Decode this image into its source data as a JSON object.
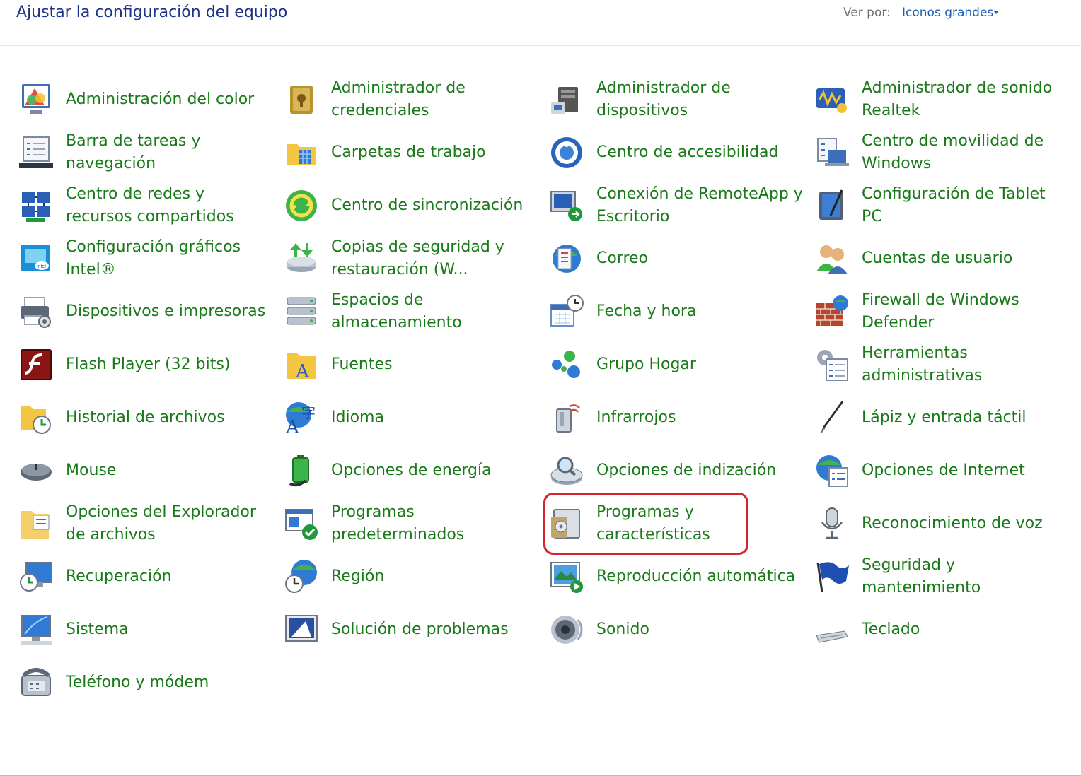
{
  "header": {
    "title": "Ajustar la configuración del equipo",
    "view_by_label": "Ver por:",
    "view_by_value": "Iconos grandes"
  },
  "items": [
    {
      "label": "Administración del color",
      "icon": "color-management-icon"
    },
    {
      "label": "Administrador de credenciales",
      "icon": "credential-manager-icon"
    },
    {
      "label": "Administrador de dispositivos",
      "icon": "device-manager-icon"
    },
    {
      "label": "Administrador de sonido Realtek",
      "icon": "realtek-audio-icon"
    },
    {
      "label": "Barra de tareas y navegación",
      "icon": "taskbar-icon"
    },
    {
      "label": "Carpetas de trabajo",
      "icon": "work-folders-icon"
    },
    {
      "label": "Centro de accesibilidad",
      "icon": "ease-of-access-icon"
    },
    {
      "label": "Centro de movilidad de Windows",
      "icon": "mobility-center-icon"
    },
    {
      "label": "Centro de redes y recursos compartidos",
      "icon": "network-center-icon"
    },
    {
      "label": "Centro de sincronización",
      "icon": "sync-center-icon"
    },
    {
      "label": "Conexión de RemoteApp y Escritorio",
      "icon": "remoteapp-icon"
    },
    {
      "label": "Configuración de Tablet PC",
      "icon": "tablet-pc-icon"
    },
    {
      "label": "Configuración gráficos Intel®",
      "icon": "intel-graphics-icon"
    },
    {
      "label": "Copias de seguridad y restauración (W...",
      "icon": "backup-restore-icon"
    },
    {
      "label": "Correo",
      "icon": "mail-icon"
    },
    {
      "label": "Cuentas de usuario",
      "icon": "user-accounts-icon"
    },
    {
      "label": "Dispositivos e impresoras",
      "icon": "printer-icon"
    },
    {
      "label": "Espacios de almacenamiento",
      "icon": "storage-spaces-icon"
    },
    {
      "label": "Fecha y hora",
      "icon": "date-time-icon"
    },
    {
      "label": "Firewall de Windows Defender",
      "icon": "firewall-icon"
    },
    {
      "label": "Flash Player (32 bits)",
      "icon": "flash-player-icon"
    },
    {
      "label": "Fuentes",
      "icon": "fonts-icon"
    },
    {
      "label": "Grupo Hogar",
      "icon": "homegroup-icon"
    },
    {
      "label": "Herramientas administrativas",
      "icon": "admin-tools-icon"
    },
    {
      "label": "Historial de archivos",
      "icon": "file-history-icon"
    },
    {
      "label": "Idioma",
      "icon": "language-icon"
    },
    {
      "label": "Infrarrojos",
      "icon": "infrared-icon"
    },
    {
      "label": "Lápiz y entrada táctil",
      "icon": "pen-icon"
    },
    {
      "label": "Mouse",
      "icon": "mouse-icon"
    },
    {
      "label": "Opciones de energía",
      "icon": "power-options-icon"
    },
    {
      "label": "Opciones de indización",
      "icon": "indexing-icon"
    },
    {
      "label": "Opciones de Internet",
      "icon": "internet-options-icon"
    },
    {
      "label": "Opciones del Explorador de archivos",
      "icon": "folder-options-icon"
    },
    {
      "label": "Programas predeterminados",
      "icon": "default-programs-icon"
    },
    {
      "label": "Programas y características",
      "icon": "programs-features-icon"
    },
    {
      "label": "Reconocimiento de voz",
      "icon": "microphone-icon"
    },
    {
      "label": "Recuperación",
      "icon": "recovery-icon"
    },
    {
      "label": "Región",
      "icon": "region-icon"
    },
    {
      "label": "Reproducción automática",
      "icon": "autoplay-icon"
    },
    {
      "label": "Seguridad y mantenimiento",
      "icon": "security-flag-icon"
    },
    {
      "label": "Sistema",
      "icon": "system-icon"
    },
    {
      "label": "Solución de problemas",
      "icon": "troubleshooting-icon"
    },
    {
      "label": "Sonido",
      "icon": "speaker-icon"
    },
    {
      "label": "Teclado",
      "icon": "keyboard-icon"
    },
    {
      "label": "Teléfono y módem",
      "icon": "phone-modem-icon"
    }
  ],
  "colors": {
    "title": "#1e3287",
    "item_text": "#1a7a1a",
    "link": "#1a5fb4",
    "highlight": "#d6242d"
  }
}
